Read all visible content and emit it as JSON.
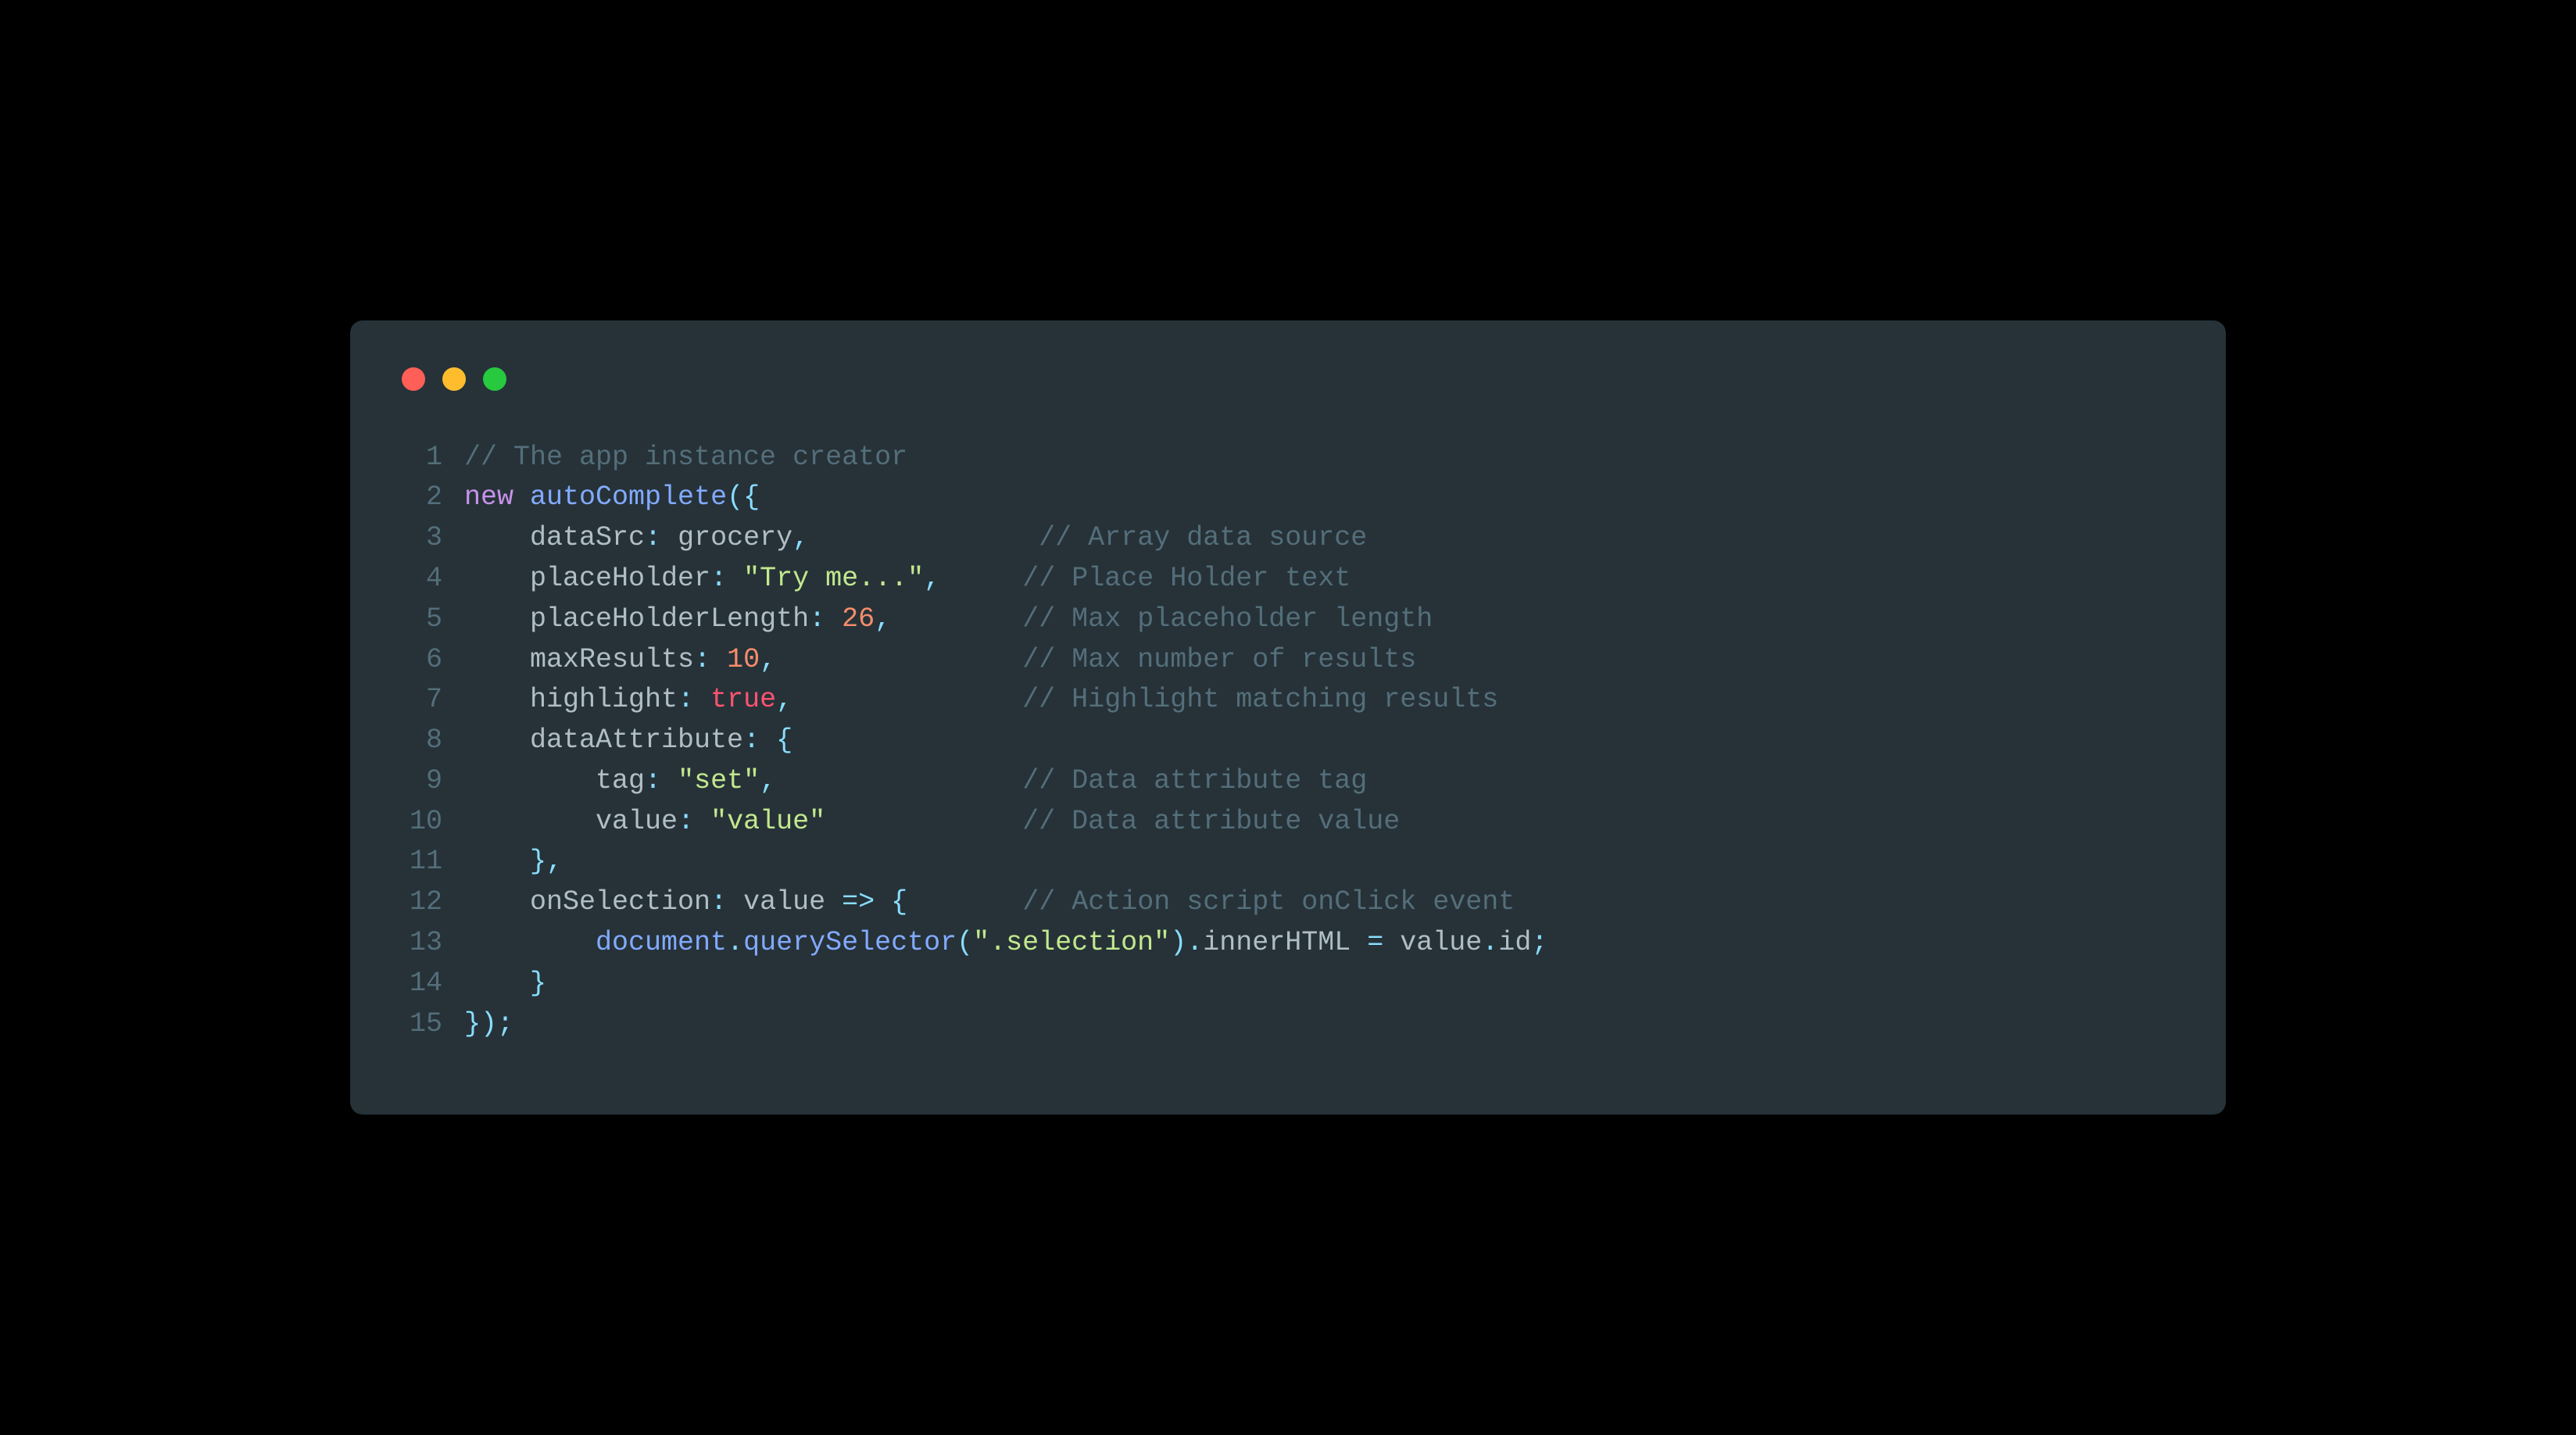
{
  "window": {
    "traffic_lights": {
      "close": "red",
      "minimize": "yellow",
      "zoom": "green"
    }
  },
  "lines": [
    {
      "n": "1",
      "tokens": [
        {
          "cls": "tok-comment",
          "t": "// The app instance creator"
        }
      ]
    },
    {
      "n": "2",
      "tokens": [
        {
          "cls": "tok-keyword",
          "t": "new"
        },
        {
          "cls": "tok-plain",
          "t": " "
        },
        {
          "cls": "tok-class",
          "t": "autoComplete"
        },
        {
          "cls": "tok-punct",
          "t": "({"
        }
      ]
    },
    {
      "n": "3",
      "tokens": [
        {
          "cls": "tok-plain",
          "t": "    "
        },
        {
          "cls": "tok-prop",
          "t": "dataSrc"
        },
        {
          "cls": "tok-punct",
          "t": ":"
        },
        {
          "cls": "tok-plain",
          "t": " grocery"
        },
        {
          "cls": "tok-punct",
          "t": ","
        },
        {
          "cls": "tok-plain",
          "t": "              "
        },
        {
          "cls": "tok-comment",
          "t": "// Array data source"
        }
      ]
    },
    {
      "n": "4",
      "tokens": [
        {
          "cls": "tok-plain",
          "t": "    "
        },
        {
          "cls": "tok-prop",
          "t": "placeHolder"
        },
        {
          "cls": "tok-punct",
          "t": ":"
        },
        {
          "cls": "tok-plain",
          "t": " "
        },
        {
          "cls": "tok-string",
          "t": "\"Try me...\""
        },
        {
          "cls": "tok-punct",
          "t": ","
        },
        {
          "cls": "tok-plain",
          "t": "     "
        },
        {
          "cls": "tok-comment",
          "t": "// Place Holder text"
        }
      ]
    },
    {
      "n": "5",
      "tokens": [
        {
          "cls": "tok-plain",
          "t": "    "
        },
        {
          "cls": "tok-prop",
          "t": "placeHolderLength"
        },
        {
          "cls": "tok-punct",
          "t": ":"
        },
        {
          "cls": "tok-plain",
          "t": " "
        },
        {
          "cls": "tok-number",
          "t": "26"
        },
        {
          "cls": "tok-punct",
          "t": ","
        },
        {
          "cls": "tok-plain",
          "t": "        "
        },
        {
          "cls": "tok-comment",
          "t": "// Max placeholder length"
        }
      ]
    },
    {
      "n": "6",
      "tokens": [
        {
          "cls": "tok-plain",
          "t": "    "
        },
        {
          "cls": "tok-prop",
          "t": "maxResults"
        },
        {
          "cls": "tok-punct",
          "t": ":"
        },
        {
          "cls": "tok-plain",
          "t": " "
        },
        {
          "cls": "tok-number",
          "t": "10"
        },
        {
          "cls": "tok-punct",
          "t": ","
        },
        {
          "cls": "tok-plain",
          "t": "               "
        },
        {
          "cls": "tok-comment",
          "t": "// Max number of results"
        }
      ]
    },
    {
      "n": "7",
      "tokens": [
        {
          "cls": "tok-plain",
          "t": "    "
        },
        {
          "cls": "tok-prop",
          "t": "highlight"
        },
        {
          "cls": "tok-punct",
          "t": ":"
        },
        {
          "cls": "tok-plain",
          "t": " "
        },
        {
          "cls": "tok-bool",
          "t": "true"
        },
        {
          "cls": "tok-punct",
          "t": ","
        },
        {
          "cls": "tok-plain",
          "t": "              "
        },
        {
          "cls": "tok-comment",
          "t": "// Highlight matching results"
        }
      ]
    },
    {
      "n": "8",
      "tokens": [
        {
          "cls": "tok-plain",
          "t": "    "
        },
        {
          "cls": "tok-prop",
          "t": "dataAttribute"
        },
        {
          "cls": "tok-punct",
          "t": ":"
        },
        {
          "cls": "tok-plain",
          "t": " "
        },
        {
          "cls": "tok-punct",
          "t": "{"
        }
      ]
    },
    {
      "n": "9",
      "tokens": [
        {
          "cls": "tok-plain",
          "t": "        "
        },
        {
          "cls": "tok-prop",
          "t": "tag"
        },
        {
          "cls": "tok-punct",
          "t": ":"
        },
        {
          "cls": "tok-plain",
          "t": " "
        },
        {
          "cls": "tok-string",
          "t": "\"set\""
        },
        {
          "cls": "tok-punct",
          "t": ","
        },
        {
          "cls": "tok-plain",
          "t": "               "
        },
        {
          "cls": "tok-comment",
          "t": "// Data attribute tag"
        }
      ]
    },
    {
      "n": "10",
      "tokens": [
        {
          "cls": "tok-plain",
          "t": "        "
        },
        {
          "cls": "tok-prop",
          "t": "value"
        },
        {
          "cls": "tok-punct",
          "t": ":"
        },
        {
          "cls": "tok-plain",
          "t": " "
        },
        {
          "cls": "tok-string",
          "t": "\"value\""
        },
        {
          "cls": "tok-plain",
          "t": "            "
        },
        {
          "cls": "tok-comment",
          "t": "// Data attribute value"
        }
      ]
    },
    {
      "n": "11",
      "tokens": [
        {
          "cls": "tok-plain",
          "t": "    "
        },
        {
          "cls": "tok-punct",
          "t": "},"
        }
      ]
    },
    {
      "n": "12",
      "tokens": [
        {
          "cls": "tok-plain",
          "t": "    "
        },
        {
          "cls": "tok-prop",
          "t": "onSelection"
        },
        {
          "cls": "tok-punct",
          "t": ":"
        },
        {
          "cls": "tok-plain",
          "t": " value "
        },
        {
          "cls": "tok-op",
          "t": "=>"
        },
        {
          "cls": "tok-plain",
          "t": " "
        },
        {
          "cls": "tok-punct",
          "t": "{"
        },
        {
          "cls": "tok-plain",
          "t": "       "
        },
        {
          "cls": "tok-comment",
          "t": "// Action script onClick event"
        }
      ]
    },
    {
      "n": "13",
      "tokens": [
        {
          "cls": "tok-plain",
          "t": "        "
        },
        {
          "cls": "tok-ident",
          "t": "document"
        },
        {
          "cls": "tok-punct",
          "t": "."
        },
        {
          "cls": "tok-ident",
          "t": "querySelector"
        },
        {
          "cls": "tok-punct",
          "t": "("
        },
        {
          "cls": "tok-string",
          "t": "\".selection\""
        },
        {
          "cls": "tok-punct",
          "t": ")."
        },
        {
          "cls": "tok-prop",
          "t": "innerHTML"
        },
        {
          "cls": "tok-plain",
          "t": " "
        },
        {
          "cls": "tok-op",
          "t": "="
        },
        {
          "cls": "tok-plain",
          "t": " value"
        },
        {
          "cls": "tok-punct",
          "t": "."
        },
        {
          "cls": "tok-prop",
          "t": "id"
        },
        {
          "cls": "tok-punct",
          "t": ";"
        }
      ]
    },
    {
      "n": "14",
      "tokens": [
        {
          "cls": "tok-plain",
          "t": "    "
        },
        {
          "cls": "tok-punct",
          "t": "}"
        }
      ]
    },
    {
      "n": "15",
      "tokens": [
        {
          "cls": "tok-punct",
          "t": "});"
        }
      ]
    }
  ]
}
